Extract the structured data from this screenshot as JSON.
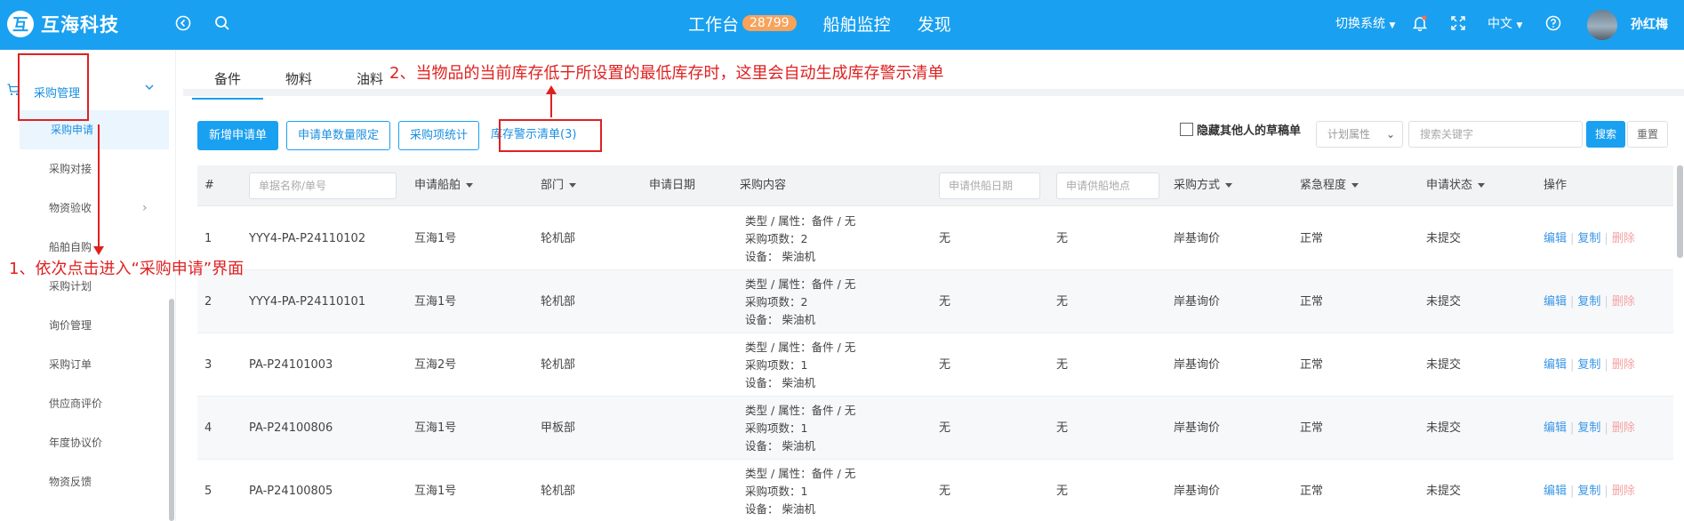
{
  "app": {
    "logo_mark": "互",
    "brand": "互海科技",
    "nav": [
      {
        "label": "工作台",
        "badge": "28799"
      },
      {
        "label": "船舶监控"
      },
      {
        "label": "发现"
      }
    ],
    "switch_system": "切换系统",
    "language": "中文",
    "user": "孙红梅"
  },
  "sidebar": {
    "group": "采购管理",
    "items": [
      "采购申请",
      "采购对接",
      "物资验收",
      "船舶自购",
      "采购计划",
      "询价管理",
      "采购订单",
      "供应商评价",
      "年度协议价",
      "物资反馈"
    ]
  },
  "tabs": [
    "备件",
    "物料",
    "油料"
  ],
  "toolbar": {
    "new_request": "新增申请单",
    "qty_limit": "申请单数量限定",
    "item_stats": "采购项统计",
    "stock_alert": "库存警示清单(3)"
  },
  "filters": {
    "hide_drafts": "隐藏其他人的草稿单",
    "plan_attr": "计划属性",
    "keyword_placeholder": "搜索关键字",
    "search": "搜索",
    "reset": "重置"
  },
  "table": {
    "headers": {
      "index": "#",
      "name_placeholder": "单据名称/单号",
      "ship": "申请船舶",
      "dept": "部门",
      "date": "申请日期",
      "content": "采购内容",
      "supply_date_placeholder": "申请供船日期",
      "supply_place_placeholder": "申请供船地点",
      "method": "采购方式",
      "urgency": "紧急程度",
      "status": "申请状态",
      "ops": "操作"
    },
    "rows": [
      {
        "idx": "1",
        "no": "YYY4-PA-P24110102",
        "ship": "互海1号",
        "dept": "轮机部",
        "c1": "类型 / 属性：备件 / 无",
        "c2": "采购项数：2",
        "c3": "设备：  柴油机",
        "supply_date": "无",
        "supply_place": "无",
        "method": "岸基询价",
        "urgency": "正常",
        "status": "未提交"
      },
      {
        "idx": "2",
        "no": "YYY4-PA-P24110101",
        "ship": "互海1号",
        "dept": "轮机部",
        "c1": "类型 / 属性：备件 / 无",
        "c2": "采购项数：2",
        "c3": "设备：  柴油机",
        "supply_date": "无",
        "supply_place": "无",
        "method": "岸基询价",
        "urgency": "正常",
        "status": "未提交"
      },
      {
        "idx": "3",
        "no": "PA-P24101003",
        "ship": "互海2号",
        "dept": "轮机部",
        "c1": "类型 / 属性：备件 / 无",
        "c2": "采购项数：1",
        "c3": "设备：  柴油机",
        "supply_date": "无",
        "supply_place": "无",
        "method": "岸基询价",
        "urgency": "正常",
        "status": "未提交"
      },
      {
        "idx": "4",
        "no": "PA-P24100806",
        "ship": "互海1号",
        "dept": "甲板部",
        "c1": "类型 / 属性：备件 / 无",
        "c2": "采购项数：1",
        "c3": "设备：  柴油机",
        "supply_date": "无",
        "supply_place": "无",
        "method": "岸基询价",
        "urgency": "正常",
        "status": "未提交"
      },
      {
        "idx": "5",
        "no": "PA-P24100805",
        "ship": "互海1号",
        "dept": "轮机部",
        "c1": "类型 / 属性：备件 / 无",
        "c2": "采购项数：1",
        "c3": "设备：  柴油机",
        "supply_date": "无",
        "supply_place": "无",
        "method": "岸基询价",
        "urgency": "正常",
        "status": "未提交"
      }
    ],
    "ops": {
      "edit": "编辑",
      "copy": "复制",
      "delete": "删除"
    }
  },
  "annotations": {
    "step1": "1、依次点击进入“采购申请”界面",
    "step2": "2、当物品的当前库存低于所设置的最低库存时，这里会自动生成库存警示清单"
  },
  "colors": {
    "primary": "#1aa0f0",
    "annotation": "#e02020"
  }
}
